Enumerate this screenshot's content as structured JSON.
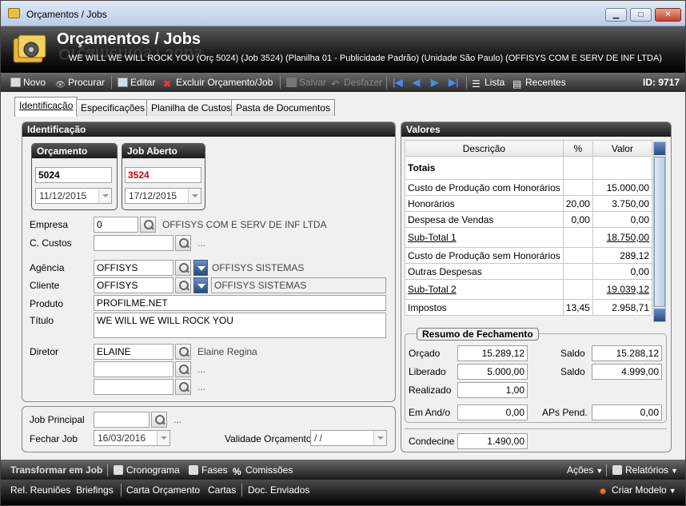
{
  "window": {
    "title": "Orçamentos / Jobs"
  },
  "header": {
    "title": "Orçamentos / Jobs",
    "subtitle": "WE WILL WE WILL ROCK YOU (Orç 5024) (Job 3524)  (Planilha 01 - Publicidade Padrão) (Unidade São Paulo) (OFFISYS COM E SERV DE INF LTDA)"
  },
  "toolbar": {
    "novo": "Novo",
    "procurar": "Procurar",
    "editar": "Editar",
    "excluir": "Excluir Orçamento/Job",
    "salvar": "Salvar",
    "desfazer": "Desfazer",
    "lista": "Lista",
    "recentes": "Recentes",
    "id": "ID: 9717"
  },
  "tabs": [
    "Identificação",
    "Especificações",
    "Planilha de Custos",
    "Pasta de Documentos"
  ],
  "ident": {
    "panel_title": "Identificação",
    "orcamento_title": "Orçamento",
    "orcamento_num": "5024",
    "orcamento_date": "11/12/2015",
    "job_title": "Job Aberto",
    "job_num": "3524",
    "job_date": "17/12/2015",
    "empresa_label": "Empresa",
    "empresa_code": "0",
    "empresa_name": "OFFISYS COM E SERV DE INF LTDA",
    "ccustos_label": "C. Custos",
    "ellipsis": "...",
    "agencia_label": "Agência",
    "agencia_code": "OFFISYS",
    "agencia_name": "OFFISYS SISTEMAS",
    "cliente_label": "Cliente",
    "cliente_code": "OFFISYS",
    "cliente_name": "OFFISYS SISTEMAS",
    "produto_label": "Produto",
    "produto_value": "PROFILME.NET",
    "titulo_label": "Título",
    "titulo_value": "WE WILL WE WILL ROCK YOU",
    "diretor_label": "Diretor",
    "diretor_code": "ELAINE",
    "diretor_name": "Elaine Regina"
  },
  "lower": {
    "job_principal_label": "Job Principal",
    "fechar_job_label": "Fechar Job",
    "fechar_job_value": "16/03/2016",
    "validade_label": "Validade Orçamento",
    "validade_value": " /  /"
  },
  "valores": {
    "panel_title": "Valores",
    "columns": [
      "Descrição",
      "%",
      "Valor"
    ],
    "rows": [
      {
        "d": "Totais",
        "p": "",
        "v": ""
      },
      {
        "d": "Custo de Produção com Honorários",
        "p": "",
        "v": "15.000,00"
      },
      {
        "d": "Honorários",
        "p": "20,00",
        "v": "3.750,00"
      },
      {
        "d": "Despesa de Vendas",
        "p": "0,00",
        "v": "0,00"
      },
      {
        "d": "Sub-Total 1",
        "p": "",
        "v": "18.750,00"
      },
      {
        "d": "Custo de Produção sem Honorários",
        "p": "",
        "v": "289,12"
      },
      {
        "d": "Outras Despesas",
        "p": "",
        "v": "0,00"
      },
      {
        "d": "Sub-Total 2",
        "p": "",
        "v": "19.039,12"
      },
      {
        "d": "Impostos",
        "p": "13,45",
        "v": "2.958,71"
      }
    ],
    "resumo_title": "Resumo de Fechamento",
    "orcado_label": "Orçado",
    "orcado_value": "15.289,12",
    "saldo_label": "Saldo",
    "saldo1_value": "15.288,12",
    "liberado_label": "Liberado",
    "liberado_value": "5.000,00",
    "saldo2_value": "4.999,00",
    "realizado_label": "Realizado",
    "realizado_value": "1,00",
    "emando_label": "Em And/o",
    "emando_value": "0,00",
    "aps_label": "APs Pend.",
    "aps_value": "0,00",
    "condecine_label": "Condecine",
    "condecine_value": "1.490,00"
  },
  "bottom": {
    "transformar": "Transformar em Job",
    "cronograma": "Cronograma",
    "fases": "Fases",
    "comissoes": "Comissões",
    "acoes": "Ações",
    "relatorios": "Relatórios",
    "rel_reunioes": "Rel. Reuniões",
    "briefings": "Briefings",
    "carta_orcamento": "Carta Orçamento",
    "cartas": "Cartas",
    "doc_enviados": "Doc. Enviados",
    "criar_modelo": "Criar Modelo"
  }
}
